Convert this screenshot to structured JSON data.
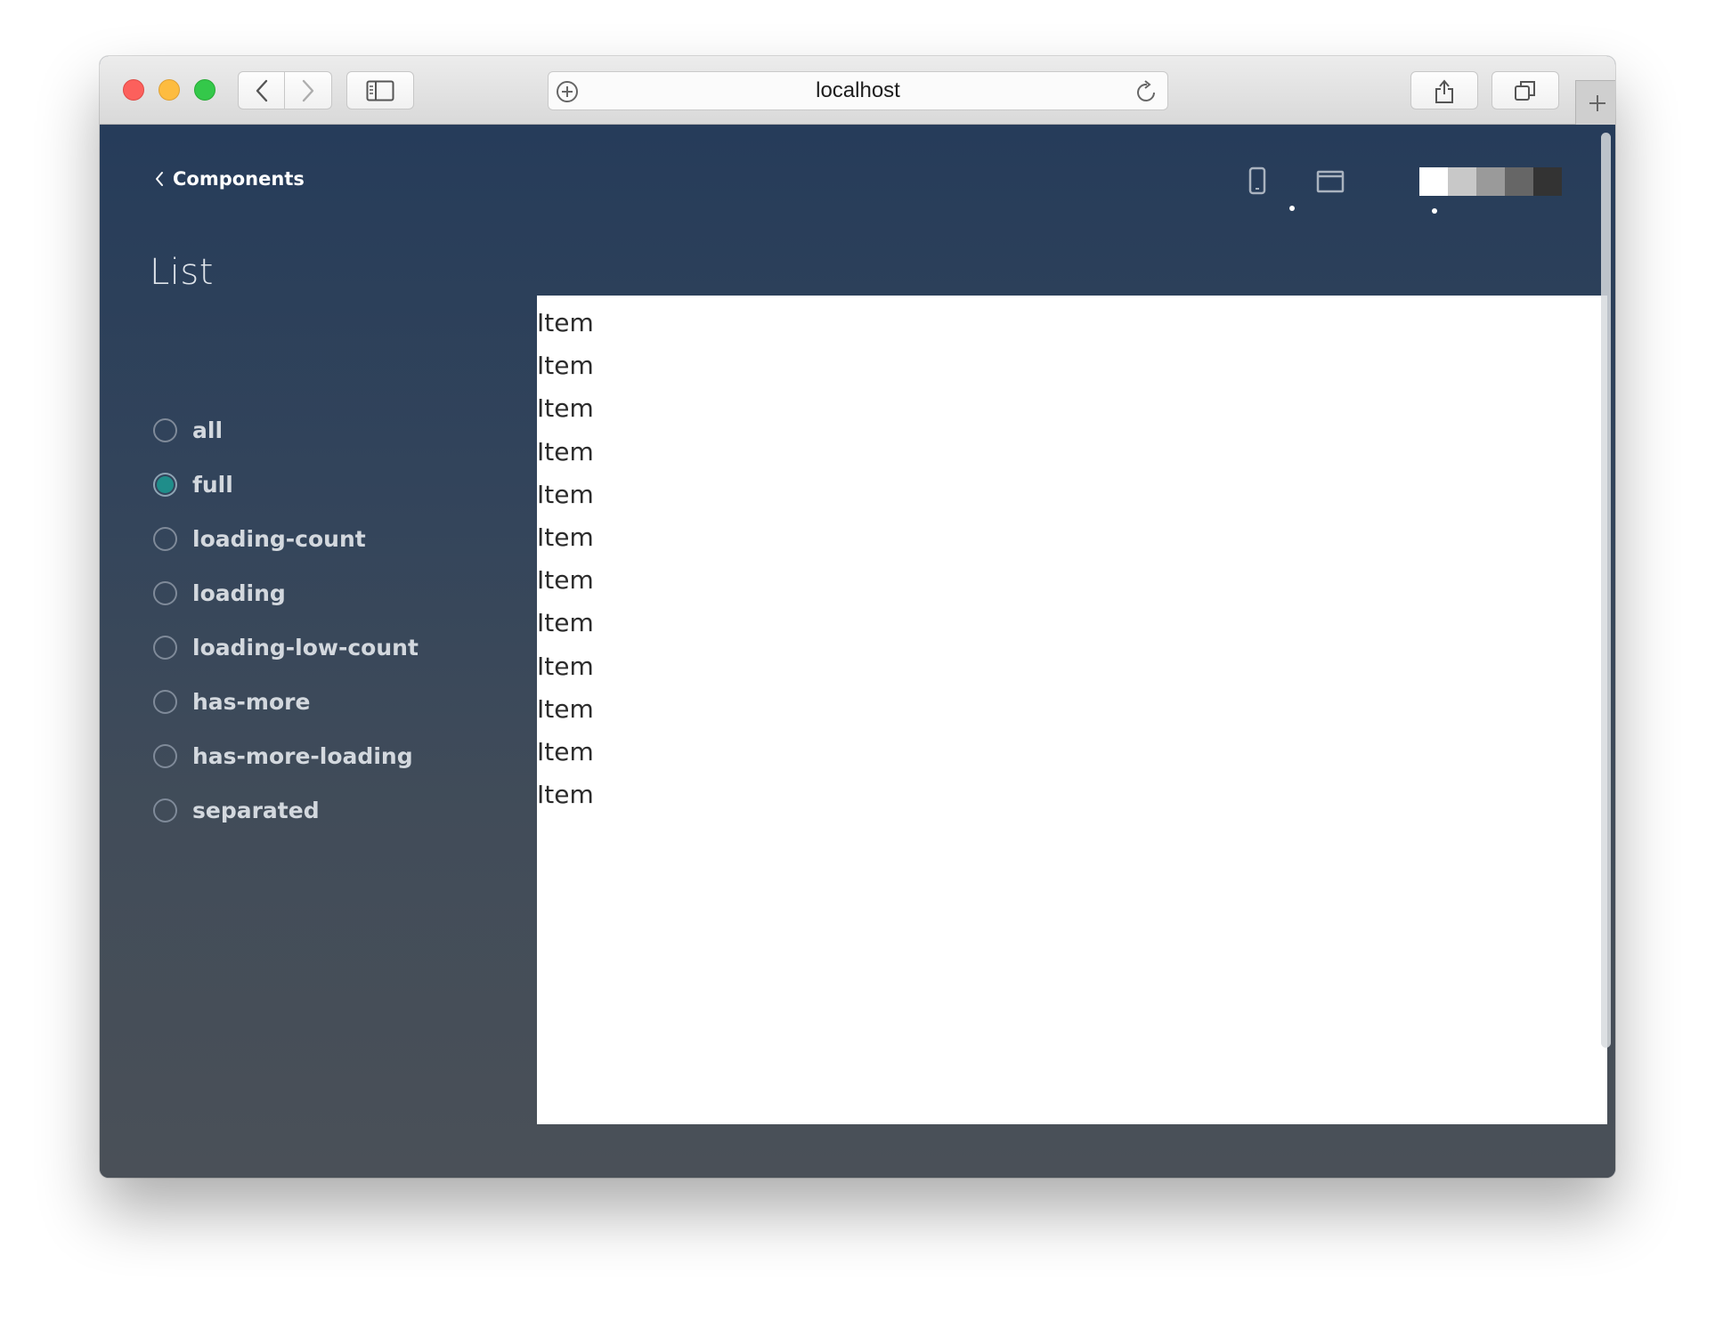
{
  "browser": {
    "url": "localhost"
  },
  "header": {
    "back_link": "Components",
    "swatch_colors": [
      "#ffffff",
      "#c8c8c8",
      "#9a9a9a",
      "#666666",
      "#333333"
    ]
  },
  "sidebar": {
    "title": "List",
    "variants": [
      {
        "label": "all",
        "checked": false
      },
      {
        "label": "full",
        "checked": true
      },
      {
        "label": "loading-count",
        "checked": false
      },
      {
        "label": "loading",
        "checked": false
      },
      {
        "label": "loading-low-count",
        "checked": false
      },
      {
        "label": "has-more",
        "checked": false
      },
      {
        "label": "has-more-loading",
        "checked": false
      },
      {
        "label": "separated",
        "checked": false
      }
    ]
  },
  "preview": {
    "items": [
      "Item",
      "Item",
      "Item",
      "Item",
      "Item",
      "Item",
      "Item",
      "Item",
      "Item",
      "Item",
      "Item",
      "Item"
    ]
  },
  "colors": {
    "radio_selected": "#1f8d8a",
    "page_background_top": "#263c5a",
    "page_background_bottom": "#4a5058"
  }
}
